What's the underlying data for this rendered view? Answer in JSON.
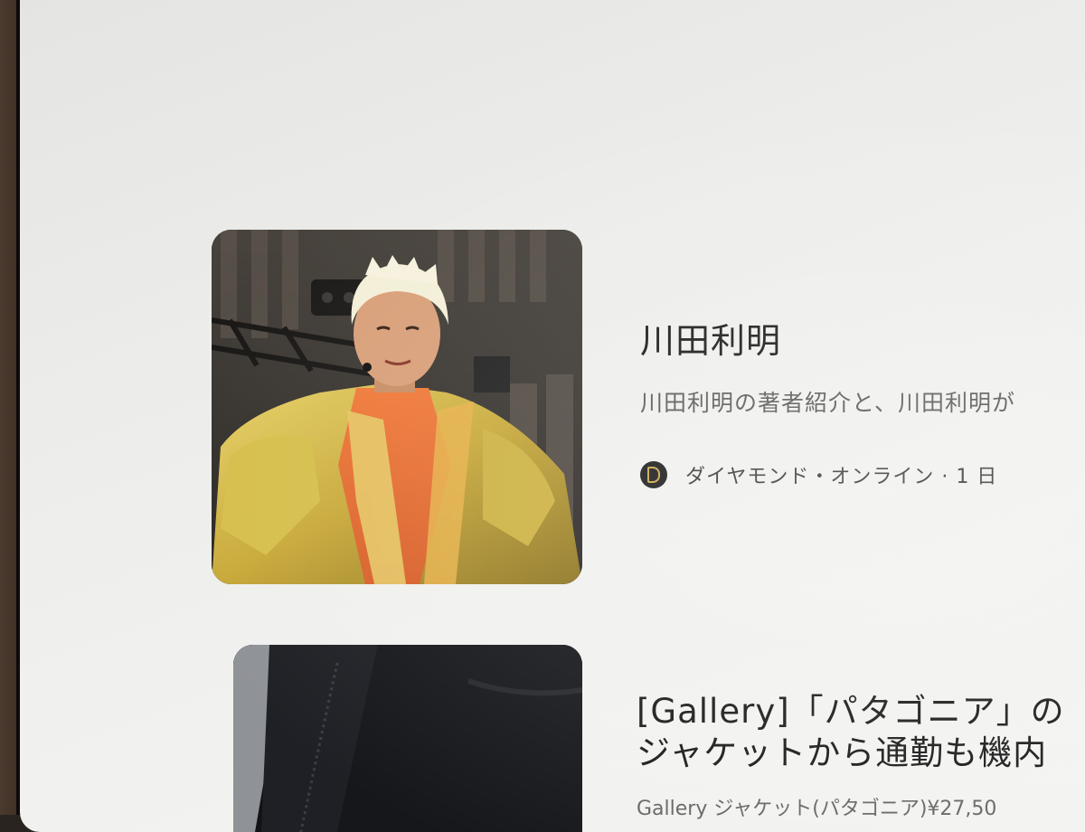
{
  "results": [
    {
      "title": "川田利明",
      "snippet": "川田利明の著者紹介と、川田利明が",
      "source": "ダイヤモンド・オンライン · 1 日",
      "thumbnail": "performer-photo"
    },
    {
      "title_line1": "[Gallery]「パタゴニア」の",
      "title_line2": "ジャケットから通勤も機内",
      "snippet": "Gallery ジャケット(パタゴニア)¥27,50",
      "thumbnail": "jacket-photo"
    }
  ],
  "colors": {
    "screen_bg": "#efefed",
    "title_text": "#1a1a1a",
    "snippet_text": "#5a5a5a",
    "source_logo_bg": "#1c1c1c",
    "source_logo_accent": "#c9a94c"
  }
}
